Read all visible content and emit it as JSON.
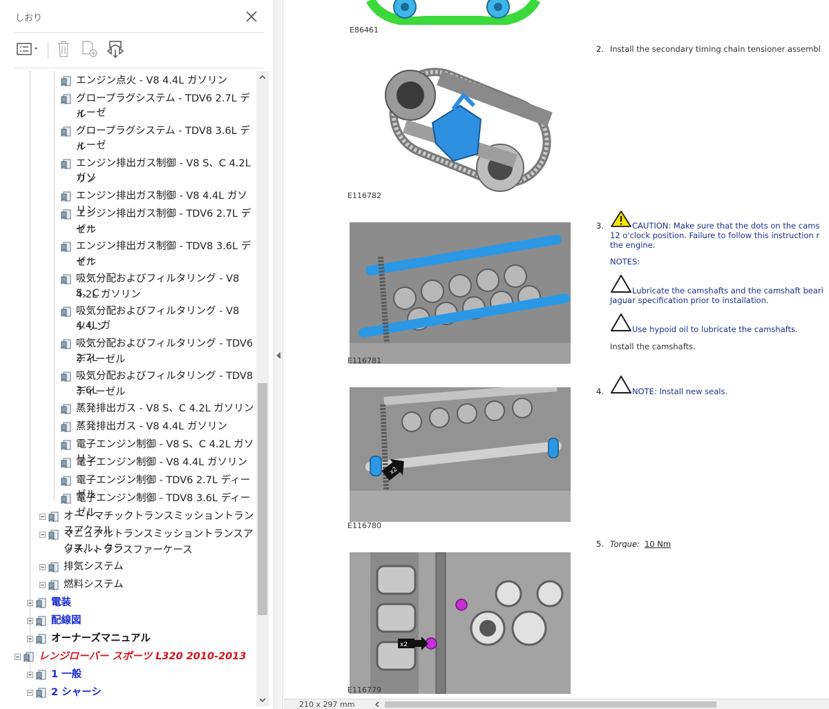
{
  "sidebar": {
    "title": "しおり",
    "items": [
      {
        "label": "エンジン点火 - V8 4.4L ガソリン",
        "lines": [
          "エンジン点火 - V8 4.4L ガソリン"
        ]
      },
      {
        "label": "グロープラグシステム - TDV6 2.7L ディーゼル",
        "lines": [
          "グロープラグシステム - TDV6 2.7L ディーゼ",
          "ル"
        ]
      },
      {
        "label": "グロープラグシステム - TDV8 3.6L ディーゼル",
        "lines": [
          "グロープラグシステム - TDV8 3.6L ディーゼ",
          "ル"
        ]
      },
      {
        "label": "エンジン排出ガス制御 - V8 S、C 4.2L ガソリン",
        "lines": [
          "エンジン排出ガス制御 - V8 S、C 4.2L ガソ",
          "リン"
        ]
      },
      {
        "label": "エンジン排出ガス制御 - V8 4.4L ガソリン",
        "lines": [
          "エンジン排出ガス制御 - V8 4.4L ガソリン"
        ]
      },
      {
        "label": "エンジン排出ガス制御 - TDV6 2.7L ディーゼル",
        "lines": [
          "エンジン排出ガス制御 - TDV6 2.7L ディー",
          "ゼル"
        ]
      },
      {
        "label": "エンジン排出ガス制御 - TDV8 3.6L ディーゼル",
        "lines": [
          "エンジン排出ガス制御 - TDV8 3.6L ディー",
          "ゼル"
        ]
      },
      {
        "label": "吸気分配およびフィルタリング - V8 S、C 4.2L ガソリン",
        "lines": [
          "吸気分配およびフィルタリング - V8 S、C",
          "4.2L ガソリン"
        ]
      },
      {
        "label": "吸気分配およびフィルタリング - V8 4.4L ガソリン",
        "lines": [
          "吸気分配およびフィルタリング - V8 4.4L ガ",
          "ソリン"
        ]
      },
      {
        "label": "吸気分配およびフィルタリング - TDV6 2.7L ディーゼル",
        "lines": [
          "吸気分配およびフィルタリング - TDV6 2.7L",
          "ディーゼル"
        ]
      },
      {
        "label": "吸気分配およびフィルタリング - TDV8 3.6L ディーゼル",
        "lines": [
          "吸気分配およびフィルタリング - TDV8 3.6L",
          "ディーゼル"
        ]
      },
      {
        "label": "蒸発排出ガス - V8 S、C 4.2L ガソリン",
        "lines": [
          "蒸発排出ガス - V8 S、C 4.2L ガソリン"
        ]
      },
      {
        "label": "蒸発排出ガス - V8 4.4L ガソリン",
        "lines": [
          "蒸発排出ガス - V8 4.4L ガソリン"
        ]
      },
      {
        "label": "電子エンジン制御 - V8 S、C 4.2L ガソリン",
        "lines": [
          "電子エンジン制御 - V8 S、C 4.2L ガソリン"
        ]
      },
      {
        "label": "電子エンジン制御 - V8 4.4L ガソリン",
        "lines": [
          "電子エンジン制御 - V8 4.4L ガソリン"
        ]
      },
      {
        "label": "電子エンジン制御 - TDV6 2.7L ディーゼル",
        "lines": [
          "電子エンジン制御 - TDV6 2.7L ディーゼル"
        ]
      },
      {
        "label": "電子エンジン制御 - TDV8 3.6L ディーゼル",
        "lines": [
          "電子エンジン制御 - TDV8 3.6L ディーゼル"
        ]
      }
    ],
    "groups": [
      {
        "lines": [
          "オートマチックトランスミッショントランスアクスル"
        ]
      },
      {
        "lines": [
          "マニュアルトランスミッショントランスアクスル、クラ",
          "ッチ、トランスファーケース"
        ]
      },
      {
        "lines": [
          "排気システム"
        ]
      },
      {
        "lines": [
          "燃料システム"
        ]
      }
    ],
    "categories": [
      {
        "label": "電装",
        "style": "cat"
      },
      {
        "label": "配線図",
        "style": "cat"
      },
      {
        "label": "オーナーズマニュアル",
        "style": "cat-black"
      },
      {
        "label": "レンジローバー スポーツ L320 2010-2013",
        "style": "cat-red"
      },
      {
        "label": "1 一般",
        "style": "sub"
      },
      {
        "label": "2 シャーシ",
        "style": "sub"
      }
    ]
  },
  "document": {
    "figures": [
      "E86461",
      "E116782",
      "E116781",
      "E116780",
      "E116779"
    ],
    "steps": {
      "s2": {
        "num": "2.",
        "text": "Install the secondary timing chain tensioner assembl"
      },
      "s3": {
        "num": "3.",
        "caution_label": "CAUTION:",
        "caution_line1": " Make sure that the dots on the cams",
        "caution_line2": "12 o'clock position. Failure to follow this instruction r",
        "caution_line3": "the engine.",
        "notes_label": "NOTES:",
        "note1_line1": "Lubricate the camshafts and the camshaft beari",
        "note1_line2": "Jaguar specification prior to installation.",
        "note2": "Use hypoid oil to lubricate the camshafts.",
        "install": "Install the camshafts."
      },
      "s4": {
        "num": "4.",
        "note_label": "NOTE:",
        "note_text": " Install new seals."
      },
      "s5": {
        "num": "5.",
        "torque_label": "Torque:",
        "torque_value": "10 Nm"
      }
    },
    "callouts": [
      "x2",
      "x2"
    ]
  },
  "statusbar": {
    "page_size": "210 x 297 mm"
  }
}
